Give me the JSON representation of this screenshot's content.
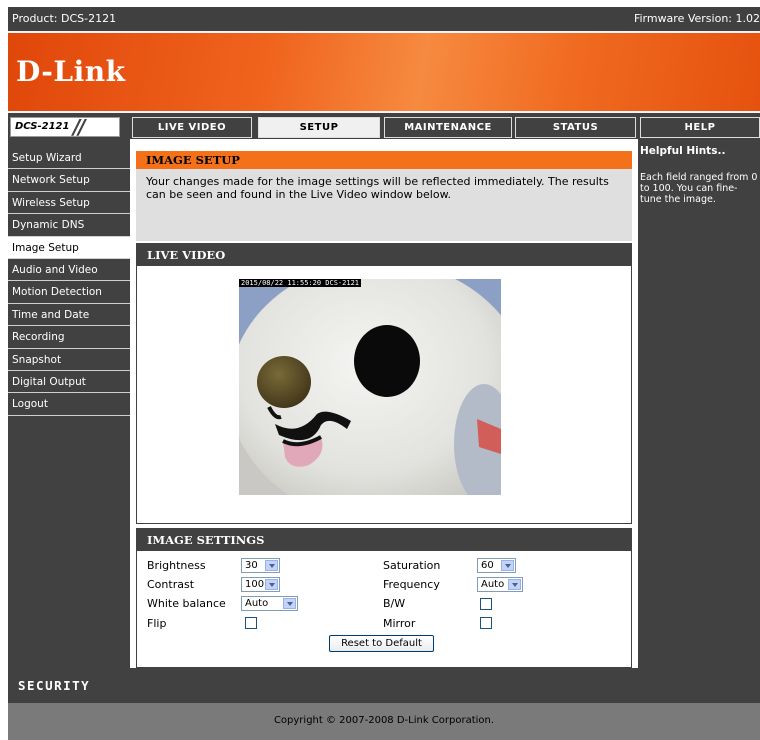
{
  "topbar": {
    "product": "Product: DCS-2121",
    "firmware": "Firmware Version: 1.02"
  },
  "brand": {
    "logo": "D-Link",
    "model": "DCS-2121",
    "slashes": "//"
  },
  "tabs": [
    {
      "label": "LIVE VIDEO",
      "active": false
    },
    {
      "label": "SETUP",
      "active": true
    },
    {
      "label": "MAINTENANCE",
      "active": false
    },
    {
      "label": "STATUS",
      "active": false
    },
    {
      "label": "HELP",
      "active": false
    }
  ],
  "sidebar": {
    "items": [
      {
        "label": "Setup Wizard"
      },
      {
        "label": "Network Setup"
      },
      {
        "label": "Wireless Setup"
      },
      {
        "label": "Dynamic DNS"
      },
      {
        "label": "Image Setup",
        "active": true
      },
      {
        "label": "Audio and Video"
      },
      {
        "label": "Motion Detection"
      },
      {
        "label": "Time and Date"
      },
      {
        "label": "Recording"
      },
      {
        "label": "Snapshot"
      },
      {
        "label": "Digital Output"
      },
      {
        "label": "Logout"
      }
    ]
  },
  "image_setup": {
    "title": "IMAGE SETUP",
    "description": "Your changes made for the image settings will be reflected immediately. The results can be seen and found in the Live Video window below."
  },
  "live_video": {
    "title": "LIVE VIDEO",
    "timestamp": "2015/08/22 11:55:20 DCS-2121"
  },
  "image_settings": {
    "title": "IMAGE SETTINGS",
    "brightness_label": "Brightness",
    "brightness_value": "30",
    "contrast_label": "Contrast",
    "contrast_value": "100",
    "white_balance_label": "White balance",
    "white_balance_value": "Auto",
    "flip_label": "Flip",
    "saturation_label": "Saturation",
    "saturation_value": "60",
    "frequency_label": "Frequency",
    "frequency_value": "Auto",
    "bw_label": "B/W",
    "mirror_label": "Mirror",
    "reset_label": "Reset to Default"
  },
  "help": {
    "title": "Helpful Hints..",
    "text": "Each field ranged from 0 to 100. You can fine-tune the image."
  },
  "footer": {
    "security": "SECURITY",
    "copyright": "Copyright © 2007-2008 D-Link Corporation."
  },
  "colors": {
    "accent": "#f4711a",
    "dark": "#414141"
  }
}
